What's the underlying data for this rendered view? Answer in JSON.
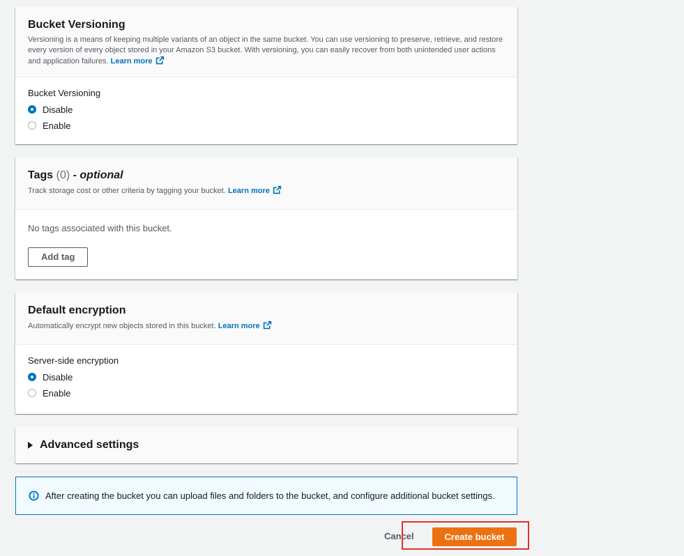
{
  "versioning": {
    "title": "Bucket Versioning",
    "description": "Versioning is a means of keeping multiple variants of an object in the same bucket. You can use versioning to preserve, retrieve, and restore every version of every object stored in your Amazon S3 bucket. With versioning, you can easily recover from both unintended user actions and application failures.",
    "learn_more": "Learn more",
    "field_label": "Bucket Versioning",
    "options": [
      "Disable",
      "Enable"
    ],
    "selected": "Disable"
  },
  "tags": {
    "title": "Tags",
    "count": "(0)",
    "optional": "- optional",
    "description": "Track storage cost or other criteria by tagging your bucket.",
    "learn_more": "Learn more",
    "empty_text": "No tags associated with this bucket.",
    "add_button": "Add tag"
  },
  "encryption": {
    "title": "Default encryption",
    "description": "Automatically encrypt new objects stored in this bucket.",
    "learn_more": "Learn more",
    "field_label": "Server-side encryption",
    "options": [
      "Disable",
      "Enable"
    ],
    "selected": "Disable"
  },
  "advanced": {
    "title": "Advanced settings"
  },
  "info": {
    "text": "After creating the bucket you can upload files and folders to the bucket, and configure additional bucket settings."
  },
  "footer": {
    "cancel": "Cancel",
    "create": "Create bucket"
  },
  "colors": {
    "primary_button": "#ec7211",
    "link": "#0073bb",
    "highlight": "#e0302b"
  }
}
